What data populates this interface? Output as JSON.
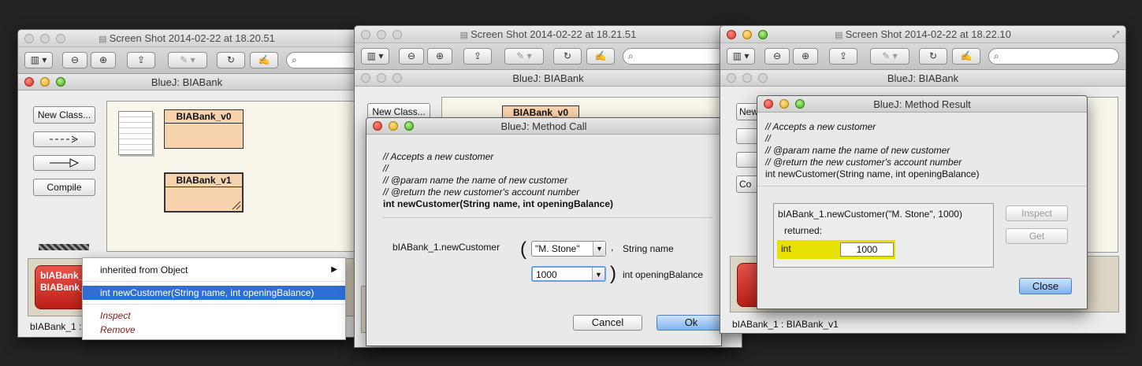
{
  "windows": [
    {
      "title": "Screen Shot 2014-02-22 at 18.20.51",
      "bluej": {
        "title": "BlueJ:  BIABank",
        "buttons": {
          "new_class": "New Class...",
          "compile": "Compile"
        },
        "classes": [
          "BIABank_v0",
          "BIABank_v1"
        ],
        "object_label_1": "bIABank_",
        "object_label_2": "BIABank_",
        "status": "bIABank_1 :"
      },
      "context_menu": {
        "inherited": "inherited from Object",
        "method": "int newCustomer(String name, int openingBalance)",
        "inspect": "Inspect",
        "remove": "Remove"
      }
    },
    {
      "title": "Screen Shot 2014-02-22 at 18.21.51",
      "bluej": {
        "title": "BlueJ:  BIABank",
        "new_class": "New Class...",
        "class_name": "BIABank_v0"
      },
      "method_call": {
        "title": "BlueJ:  Method Call",
        "comment": [
          "// Accepts a new customer",
          "//",
          "// @param name the name of new customer",
          "// @return the new customer's account number"
        ],
        "signature": "int newCustomer(String name, int openingBalance)",
        "call_prefix": "bIABank_1.newCustomer",
        "param1_value": "\"M. Stone\"",
        "param1_label": "String name",
        "param2_value": "1000",
        "param2_label": "int openingBalance",
        "cancel": "Cancel",
        "ok": "Ok"
      }
    },
    {
      "title": "Screen Shot 2014-02-22 at 18.22.10",
      "bluej": {
        "title": "BlueJ:  BIABank",
        "new_class_partial": "New",
        "compile_partial": "Co",
        "status": "bIABank_1 : BIABank_v1"
      },
      "method_result": {
        "title": "BlueJ:  Method Result",
        "comment": [
          "// Accepts a new customer",
          "//",
          "// @param name the name of new customer",
          "// @return the new customer's account number"
        ],
        "signature": "int newCustomer(String name, int openingBalance)",
        "call": "bIABank_1.newCustomer(\"M. Stone\", 1000)",
        "returned": "returned:",
        "type": "int",
        "value": "1000",
        "inspect": "Inspect",
        "get": "Get",
        "close": "Close"
      }
    }
  ],
  "colors": {
    "class_fill": "#f7d3ad",
    "object_red": "#d33a30",
    "selection_blue": "#2e6fd6",
    "result_highlight": "#e9e200"
  }
}
